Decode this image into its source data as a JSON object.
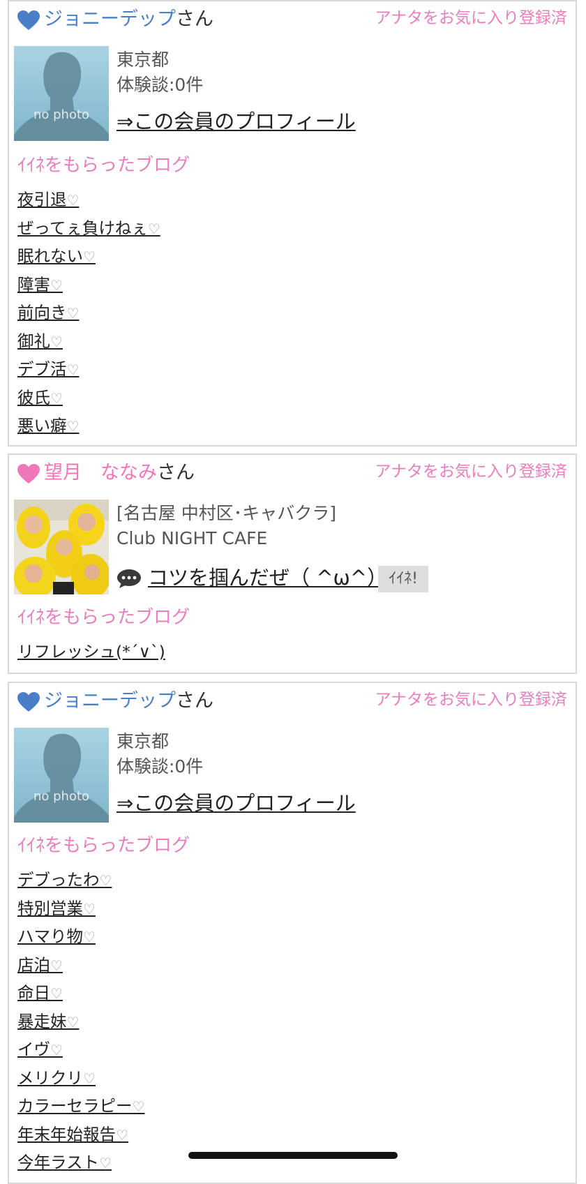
{
  "colors": {
    "accent_pink": "#e57fbe",
    "male_blue": "#4a7fc8",
    "female_pink": "#ef76b9"
  },
  "cards": [
    {
      "heart_icon": "heart-blue",
      "member_name": "ジョニーデップ",
      "name_color": "#4a7fc8",
      "name_suffix": "さん",
      "favorite_status": "アナタをお気に入り登録済",
      "avatar_label": "no photo",
      "location": "東京都",
      "reviews": "体験談:0件",
      "profile_link": "⇒この会員のプロフィール",
      "section_title": "ｲｲﾈをもらったブログ",
      "blogs": [
        "夜引退",
        "ぜってぇ負けねぇ",
        "眠れない",
        "障害",
        "前向き",
        "御礼",
        "デブ活",
        "彼氏",
        "悪い癖"
      ],
      "like_mark": "♡"
    },
    {
      "heart_icon": "heart-pink",
      "member_name": "望月　ななみ",
      "name_color": "#ef76b9",
      "name_suffix": "さん",
      "favorite_status": "アナタをお気に入り登録済",
      "shop_area": "[名古屋 中村区･キャバクラ]",
      "shop_name": "Club NIGHT CAFE",
      "post_icon": "speech-bubble-icon",
      "post_title": "コツを掴んだぜ（ ^ω^）...",
      "iine_button": "ｲｲﾈ!",
      "section_title": "ｲｲﾈをもらったブログ",
      "blogs": [
        "リフレッシュ(*´∨`)"
      ]
    },
    {
      "heart_icon": "heart-blue",
      "member_name": "ジョニーデップ",
      "name_color": "#4a7fc8",
      "name_suffix": "さん",
      "favorite_status": "アナタをお気に入り登録済",
      "avatar_label": "no photo",
      "location": "東京都",
      "reviews": "体験談:0件",
      "profile_link": "⇒この会員のプロフィール",
      "section_title": "ｲｲﾈをもらったブログ",
      "blogs": [
        "デブったわ",
        "特別営業",
        "ハマり物",
        "店泊",
        "命日",
        "暴走妹",
        "イヴ",
        "メリクリ",
        "カラーセラピー",
        "年末年始報告",
        "今年ラスト"
      ],
      "like_mark": "♡"
    }
  ]
}
